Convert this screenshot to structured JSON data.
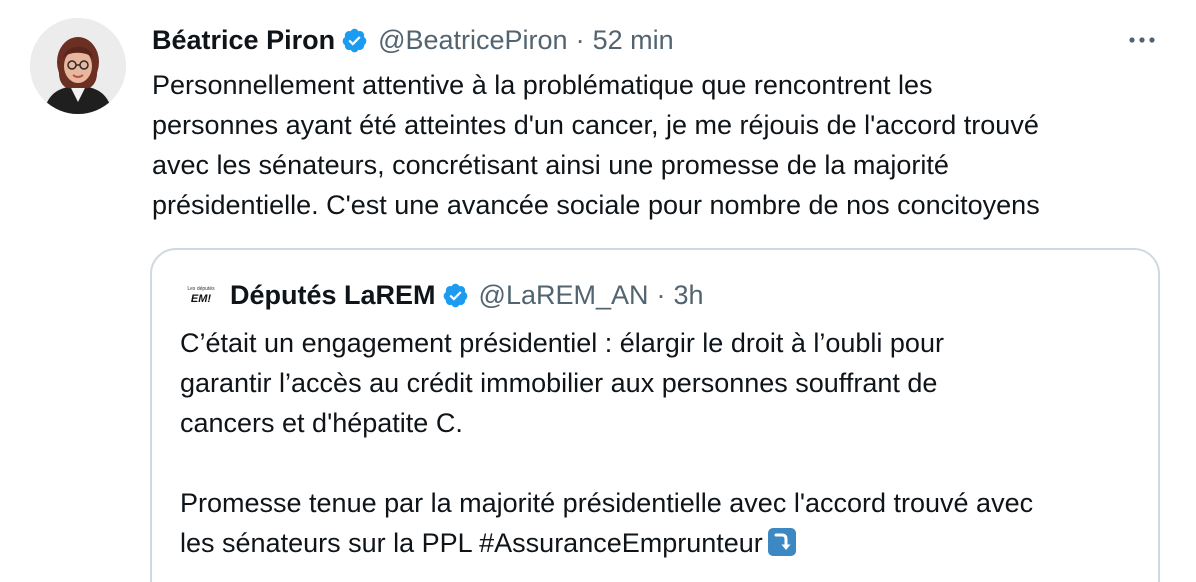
{
  "tweet": {
    "author": {
      "name": "Béatrice Piron",
      "handle": "@BeatricePiron",
      "avatar_icon": "profile-photo",
      "verified_icon": "verified-badge-icon"
    },
    "separator": "·",
    "time": "52 min",
    "more_icon": "more-options-icon",
    "text_lines": [
      "Personnellement attentive à la problématique que rencontrent les",
      "personnes ayant été atteintes d'un cancer, je me réjouis de l'accord trouvé",
      "avec les sénateurs, concrétisant ainsi une promesse de la majorité",
      "présidentielle. C'est une avancée sociale pour nombre de nos concitoyens"
    ]
  },
  "quote": {
    "author": {
      "name": "Députés LaREM",
      "handle": "@LaREM_AN",
      "avatar_logo_text": "EM!",
      "avatar_logo_subtext": "Les députés"
    },
    "separator": "·",
    "time": "3h",
    "text_lines": [
      "C’était un engagement présidentiel : élargir le droit à l’oubli pour",
      "garantir l’accès au crédit immobilier aux personnes souffrant de",
      "cancers et d'hépatite C.",
      "",
      "Promesse tenue par la majorité présidentielle avec l'accord trouvé avec",
      "les sénateurs sur la PPL #AssuranceEmprunteur"
    ],
    "emoji_icon": "arrow-curving-down-emoji"
  },
  "colors": {
    "text": "#0f1419",
    "muted": "#536471",
    "verified": "#1d9bf0",
    "border": "#cfd9de",
    "emoji_bg": "#3b88c3"
  }
}
